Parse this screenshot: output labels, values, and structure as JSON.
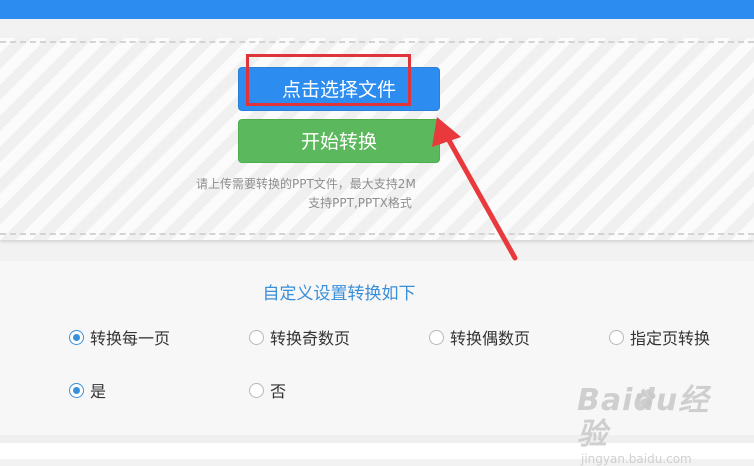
{
  "upload": {
    "select_button_label": "点击选择文件",
    "convert_button_label": "开始转换",
    "hint_line1": "请上传需要转换的PPT文件，最大支持2M",
    "hint_line2": "支持PPT,PPTX格式"
  },
  "settings": {
    "title": "自定义设置转换如下",
    "page_options": [
      {
        "label": "转换每一页",
        "checked": true
      },
      {
        "label": "转换奇数页",
        "checked": false
      },
      {
        "label": "转换偶数页",
        "checked": false
      },
      {
        "label": "指定页转换",
        "checked": false
      }
    ],
    "yes_no_options": [
      {
        "label": "是",
        "checked": true
      },
      {
        "label": "否",
        "checked": false
      }
    ]
  },
  "watermark": {
    "logo_text": "Baidu经验",
    "url_text": "jingyan.baidu.com"
  },
  "colors": {
    "accent_blue": "#2d8cf0",
    "convert_green": "#5cb85c",
    "annotation_red": "#e0343a",
    "settings_title_blue": "#3a8fd9"
  }
}
